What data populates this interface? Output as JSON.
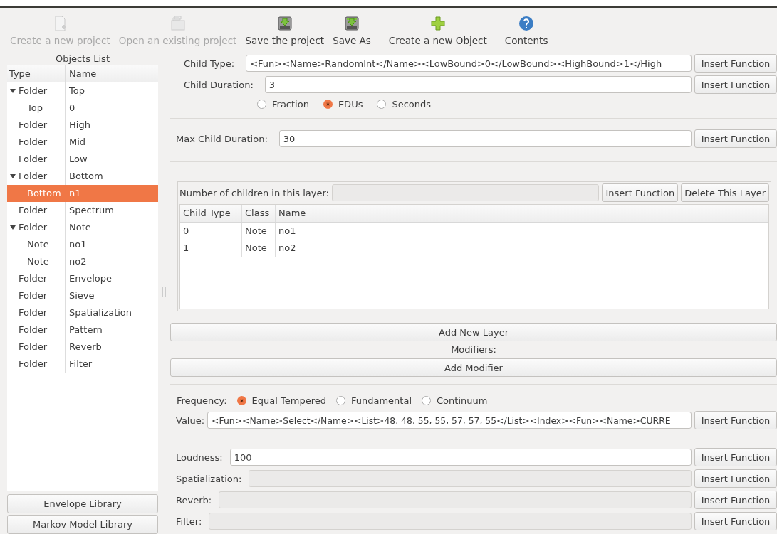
{
  "toolbar": {
    "groups": [
      {
        "items": [
          {
            "kind": "new",
            "label": "Create a new project",
            "disabled": true
          },
          {
            "kind": "open",
            "label": "Open an existing project",
            "disabled": true
          },
          {
            "kind": "save",
            "label": "Save the project",
            "disabled": false
          },
          {
            "kind": "saveas",
            "label": "Save As",
            "disabled": false
          }
        ]
      },
      {
        "items": [
          {
            "kind": "add",
            "label": "Create a new Object",
            "disabled": false
          }
        ]
      },
      {
        "items": [
          {
            "kind": "help",
            "label": "Contents",
            "disabled": false
          }
        ]
      }
    ]
  },
  "objects_list": {
    "title": "Objects List",
    "columns": [
      "Type",
      "Name"
    ],
    "items": [
      {
        "type": "Folder",
        "name": "Top",
        "selected": false,
        "expanded": true,
        "children": [
          {
            "type": "Top",
            "name": "0",
            "selected": false
          }
        ]
      },
      {
        "type": "Folder",
        "name": "High",
        "selected": false
      },
      {
        "type": "Folder",
        "name": "Mid",
        "selected": false
      },
      {
        "type": "Folder",
        "name": "Low",
        "selected": false
      },
      {
        "type": "Folder",
        "name": "Bottom",
        "selected": false,
        "expanded": true,
        "children": [
          {
            "type": "Bottom",
            "name": "n1",
            "selected": true
          }
        ]
      },
      {
        "type": "Folder",
        "name": "Spectrum",
        "selected": false
      },
      {
        "type": "Folder",
        "name": "Note",
        "selected": false,
        "expanded": true,
        "children": [
          {
            "type": "Note",
            "name": "no1",
            "selected": false
          },
          {
            "type": "Note",
            "name": "no2",
            "selected": false
          }
        ]
      },
      {
        "type": "Folder",
        "name": "Envelope",
        "selected": false
      },
      {
        "type": "Folder",
        "name": "Sieve",
        "selected": false
      },
      {
        "type": "Folder",
        "name": "Spatialization",
        "selected": false
      },
      {
        "type": "Folder",
        "name": "Pattern",
        "selected": false
      },
      {
        "type": "Folder",
        "name": "Reverb",
        "selected": false
      },
      {
        "type": "Folder",
        "name": "Filter",
        "selected": false
      }
    ],
    "buttons": [
      "Envelope Library",
      "Markov Model Library"
    ]
  },
  "child_type": {
    "label": "Child Type:",
    "value": "<Fun><Name>RandomInt</Name><LowBound>0</LowBound><HighBound>1</High",
    "button": "Insert Function"
  },
  "child_duration": {
    "label": "Child Duration:",
    "value": "3",
    "button": "Insert Function"
  },
  "duration_units": [
    {
      "label": "Fraction",
      "selected": false
    },
    {
      "label": "EDUs",
      "selected": true
    },
    {
      "label": "Seconds",
      "selected": false
    }
  ],
  "max_child_duration": {
    "label": "Max Child Duration:",
    "value": "30",
    "button": "Insert Function"
  },
  "layer": {
    "label": "Number of children in this layer:",
    "disabled": true,
    "buttons": [
      "Insert Function",
      "Delete This Layer"
    ],
    "columns": [
      "Child Type",
      "Class",
      "Name"
    ],
    "rows": [
      {
        "cells": [
          "0",
          "Note",
          "no1"
        ],
        "selected": false
      },
      {
        "cells": [
          "1",
          "Note",
          "no2"
        ],
        "selected": false
      }
    ]
  },
  "add_layer_button": "Add New Layer",
  "modifiers_label": "Modifiers:",
  "add_modifier_button": "Add Modifier",
  "frequency": {
    "label": "Frequency:",
    "options": [
      {
        "label": "Equal Tempered",
        "selected": true
      },
      {
        "label": "Fundamental",
        "selected": false
      },
      {
        "label": "Continuum",
        "selected": false
      }
    ]
  },
  "value": {
    "label": "Value:",
    "value": "<Fun><Name>Select</Name><List>48, 48, 55, 55, 57, 57, 55</List><Index><Fun><Name>CURRE",
    "button": "Insert Function"
  },
  "params": [
    {
      "label": "Loudness:",
      "value": "100",
      "disabled": false,
      "button": "Insert Function"
    },
    {
      "label": "Spatialization:",
      "disabled": true,
      "button": "Insert Function"
    },
    {
      "label": "Reverb:",
      "disabled": true,
      "button": "Insert Function"
    },
    {
      "label": "Filter:",
      "disabled": true,
      "button": "Insert Function"
    }
  ]
}
